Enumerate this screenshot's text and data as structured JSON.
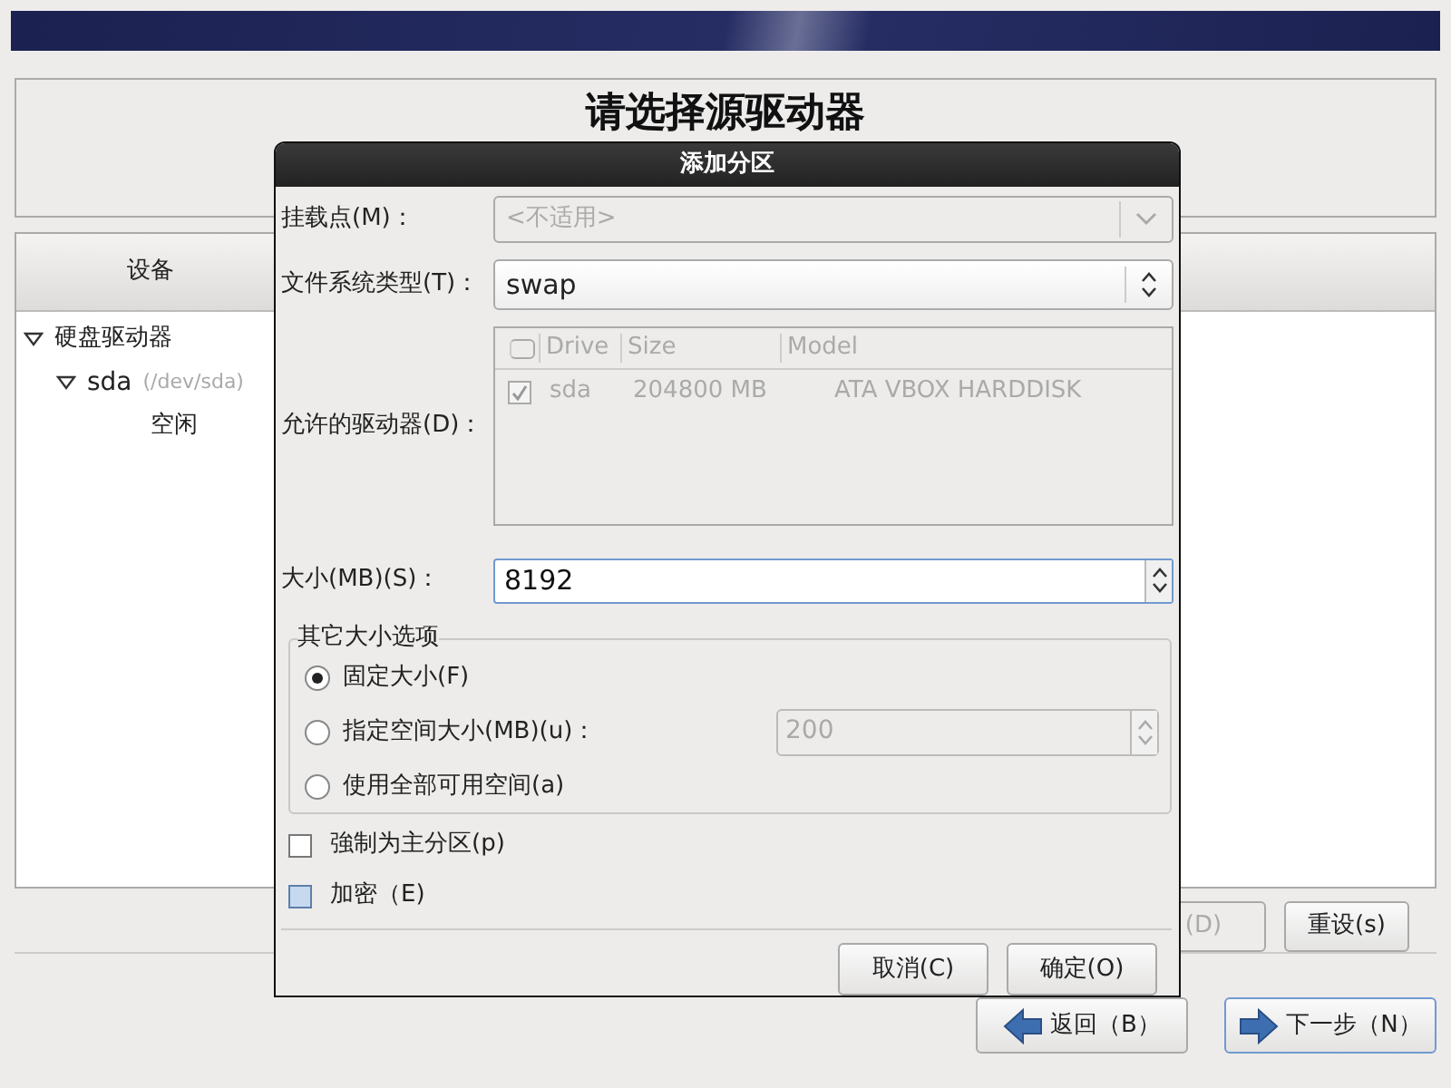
{
  "page": {
    "title": "请选择源驱动器",
    "device_panel": {
      "column": "设备",
      "tree": [
        {
          "label": "硬盘驱动器",
          "expanded": true,
          "children": [
            {
              "label": "sda",
              "detail": "(/dev/sda)",
              "expanded": true,
              "children": [
                {
                  "label": "空闲"
                }
              ]
            }
          ]
        }
      ]
    },
    "buttons": [
      {
        "label": "(D)",
        "disabled": true
      },
      {
        "label": "重设(s)",
        "disabled": false
      }
    ],
    "nav_buttons": [
      {
        "label": "返回（B）",
        "kind": "back",
        "focused": false
      },
      {
        "label": "下一步（N）",
        "kind": "next",
        "focused": true
      }
    ]
  },
  "dialog": {
    "title": "添加分区",
    "mount_point": {
      "label": "挂载点(M)：",
      "value": "<不适用>",
      "disabled": true
    },
    "fs_type": {
      "label": "文件系统类型(T)：",
      "value": "swap"
    },
    "drives": {
      "label": "允许的驱动器(D)：",
      "columns": [
        "Drive",
        "Size",
        "Model"
      ],
      "disabled": true,
      "rows": [
        {
          "checked": true,
          "drive": "sda",
          "size": "204800 MB",
          "model": "ATA VBOX HARDDISK"
        }
      ]
    },
    "size": {
      "label": "大小(MB)(S)：",
      "value": "8192"
    },
    "size_options": {
      "legend": "其它大小选项",
      "options": [
        {
          "label": "固定大小(F)",
          "selected": true
        },
        {
          "label": "指定空间大小(MB)(u)：",
          "selected": false,
          "spin_value": "200"
        },
        {
          "label": "使用全部可用空间(a)",
          "selected": false
        }
      ]
    },
    "checkboxes": [
      {
        "label": "強制为主分区(p)",
        "checked": false,
        "highlighted": false
      },
      {
        "label": "加密（E)",
        "checked": false,
        "highlighted": true
      }
    ],
    "buttons": [
      {
        "label": "取消(C)"
      },
      {
        "label": "确定(O)"
      }
    ]
  }
}
